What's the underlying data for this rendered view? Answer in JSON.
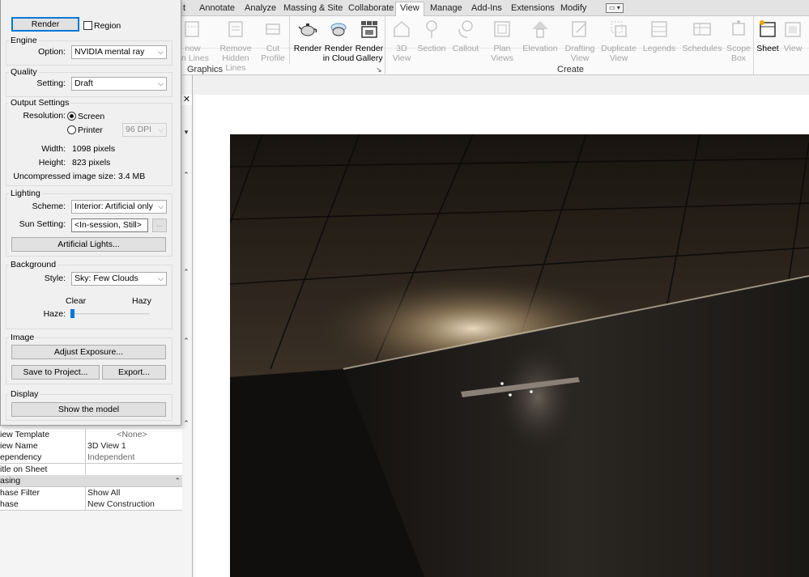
{
  "ribbon": {
    "tabs": [
      {
        "label": "t",
        "active": false
      },
      {
        "label": "Annotate",
        "active": false
      },
      {
        "label": "Analyze",
        "active": false
      },
      {
        "label": "Massing & Site",
        "active": false
      },
      {
        "label": "Collaborate",
        "active": false
      },
      {
        "label": "View",
        "active": true
      },
      {
        "label": "Manage",
        "active": false
      },
      {
        "label": "Add-Ins",
        "active": false
      },
      {
        "label": "Extensions",
        "active": false
      },
      {
        "label": "Modify",
        "active": false
      }
    ],
    "qat_glyph": "▭ ▾",
    "buttons": [
      {
        "line1": "now",
        "line2": "en Lines",
        "icon": "show-hidden-lines-icon"
      },
      {
        "line1": "Remove",
        "line2": "Hidden Lines",
        "icon": "remove-hidden-lines-icon"
      },
      {
        "line1": "Cut",
        "line2": "Profile",
        "icon": "cut-profile-icon"
      },
      {
        "line1": "Render",
        "line2": "",
        "icon": "teapot-render-icon"
      },
      {
        "line1": "Render",
        "line2": "in Cloud",
        "icon": "cloud-teapot-icon"
      },
      {
        "line1": "Render",
        "line2": "Gallery",
        "icon": "gallery-icon"
      },
      {
        "line1": "3D",
        "line2": "View",
        "icon": "house-3d-icon"
      },
      {
        "line1": "Section",
        "line2": "",
        "icon": "section-icon"
      },
      {
        "line1": "Callout",
        "line2": "",
        "icon": "callout-icon"
      },
      {
        "line1": "Plan",
        "line2": "Views",
        "icon": "plan-views-icon"
      },
      {
        "line1": "Elevation",
        "line2": "",
        "icon": "elevation-icon"
      },
      {
        "line1": "Drafting",
        "line2": "View",
        "icon": "drafting-view-icon"
      },
      {
        "line1": "Duplicate",
        "line2": "View",
        "icon": "duplicate-view-icon"
      },
      {
        "line1": "Legends",
        "line2": "",
        "icon": "legends-icon"
      },
      {
        "line1": "Schedules",
        "line2": "",
        "icon": "schedules-icon"
      },
      {
        "line1": "Scope",
        "line2": "Box",
        "icon": "scope-box-icon"
      },
      {
        "line1": "Sheet",
        "line2": "",
        "icon": "sheet-icon"
      },
      {
        "line1": "View",
        "line2": "",
        "icon": "view-icon"
      }
    ],
    "panels": {
      "graphics": "Graphics",
      "create": "Create"
    },
    "panel_launcher": "↘"
  },
  "dialog": {
    "render_button": "Render",
    "region_label": "Region",
    "engine": {
      "title": "Engine",
      "option_label": "Option:",
      "option_value": "NVIDIA mental ray"
    },
    "quality": {
      "title": "Quality",
      "setting_label": "Setting:",
      "setting_value": "Draft"
    },
    "output": {
      "title": "Output Settings",
      "resolution_label": "Resolution:",
      "screen_label": "Screen",
      "printer_label": "Printer",
      "dpi_value": "96 DPI",
      "width_label": "Width:",
      "width_value": "1098 pixels",
      "height_label": "Height:",
      "height_value": "823 pixels",
      "size_label": "Uncompressed image size:",
      "size_value": "3.4 MB"
    },
    "lighting": {
      "title": "Lighting",
      "scheme_label": "Scheme:",
      "scheme_value": "Interior: Artificial only",
      "sun_label": "Sun Setting:",
      "sun_value": "<In-session, Still>",
      "sun_browse": "...",
      "artificial_button": "Artificial Lights..."
    },
    "background": {
      "title": "Background",
      "style_label": "Style:",
      "style_value": "Sky: Few Clouds",
      "clear_label": "Clear",
      "hazy_label": "Hazy",
      "haze_label": "Haze:",
      "haze_level": 0.0
    },
    "image": {
      "title": "Image",
      "adjust_button": "Adjust Exposure...",
      "save_button": "Save to Project...",
      "export_button": "Export..."
    },
    "display": {
      "title": "Display",
      "show_button": "Show the model"
    }
  },
  "properties": {
    "partial_row": {
      "key": "iew Template",
      "value": "<None>"
    },
    "rows": [
      {
        "key": "iew Name",
        "value": "3D View 1"
      },
      {
        "key": "ependency",
        "value": "Independent"
      },
      {
        "key": "itle on Sheet",
        "value": ""
      }
    ],
    "group": {
      "label": "asing",
      "collapse": "⌃"
    },
    "phase_rows": [
      {
        "key": "hase Filter",
        "value": "Show All"
      },
      {
        "key": "hase",
        "value": "New Construction"
      }
    ],
    "close_glyph": "✕"
  },
  "colors": {
    "accent": "#0078d7",
    "render_bg": "#1e1a16"
  }
}
